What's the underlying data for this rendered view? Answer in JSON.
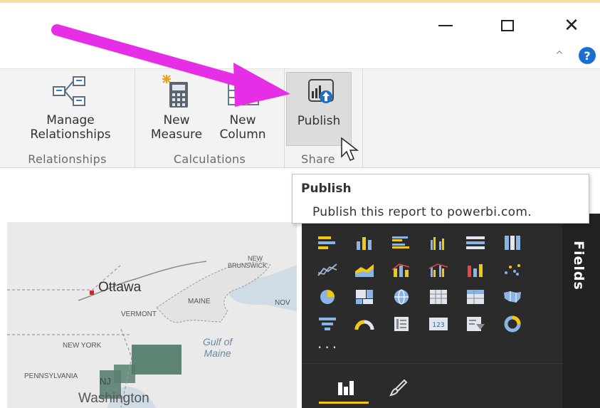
{
  "window": {
    "minimize_icon": "minimize-icon",
    "maximize_icon": "maximize-icon",
    "close_glyph": "✕",
    "collapse_glyph": "^",
    "help_glyph": "?"
  },
  "ribbon": {
    "groups": [
      {
        "label": "Relationships",
        "buttons": [
          {
            "label_line1": "Manage",
            "label_line2": "Relationships",
            "icon": "manage-relationships-icon"
          }
        ]
      },
      {
        "label": "Calculations",
        "buttons": [
          {
            "label_line1": "New",
            "label_line2": "Measure",
            "icon": "calculator-icon"
          },
          {
            "label_line1": "New",
            "label_line2": "Column",
            "icon": "table-column-icon"
          }
        ]
      },
      {
        "label": "Share",
        "buttons": [
          {
            "label_line1": "Publish",
            "icon": "publish-icon"
          }
        ]
      }
    ]
  },
  "tooltip": {
    "title": "Publish",
    "description": "Publish this report to powerbi.com."
  },
  "map": {
    "labels": {
      "ottawa": "Ottawa",
      "new_brunswick_1": "NEW",
      "new_brunswick_2": "BRUNSWICK",
      "maine": "MAINE",
      "vermont": "VERMONT",
      "nova": "NOV",
      "gulf_1": "Gulf of",
      "gulf_2": "Maine",
      "new_york": "NEW YORK",
      "pennsylvania": "PENNSYLVANIA",
      "nj": "NJ",
      "washington": "Washington"
    }
  },
  "visualizations": {
    "more": "...",
    "icons": [
      "stacked-bar-icon",
      "stacked-column-icon",
      "clustered-bar-icon",
      "clustered-column-icon",
      "100-bar-icon",
      "100-column-icon",
      "line-chart-icon",
      "area-chart-icon",
      "line-stacked-column-icon",
      "line-clustered-column-icon",
      "ribbon-chart-icon",
      "scatter-chart-icon",
      "pie-chart-icon",
      "treemap-icon",
      "globe-map-icon",
      "table-icon",
      "matrix-icon",
      "filled-map-icon",
      "funnel-icon",
      "gauge-icon",
      "multi-row-card-icon",
      "card-icon",
      "slicer-icon",
      "donut-chart-icon"
    ],
    "tabs": [
      "fields-tab-icon",
      "format-paintbrush-icon"
    ]
  },
  "fields_pane": {
    "label": "Fields"
  },
  "colors": {
    "arrow": "#e62ee6",
    "ribbon_bg": "#f3f3f3",
    "viz_bg": "#2b2b2b",
    "accent_yellow": "#f2c811",
    "help_blue": "#1a6fd0"
  }
}
